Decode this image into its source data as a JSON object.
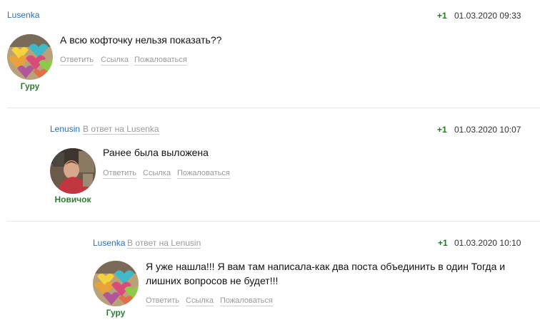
{
  "comments": [
    {
      "author": "Lusenka",
      "reply_to": "",
      "rating": "+1",
      "date": "01.03.2020 09:33",
      "rank": "Гуру",
      "text": "А всю кофточку нельзя показать??",
      "actions": {
        "reply": "Ответить",
        "link": "Ссылка",
        "report": "Пожаловаться"
      },
      "avatar": "knitted-hearts-avatar"
    },
    {
      "author": "Lenusin",
      "reply_to": "В ответ на Lusenka",
      "rating": "+1",
      "date": "01.03.2020 10:07",
      "rank": "Новичок",
      "text": "Ранее была выложена",
      "actions": {
        "reply": "Ответить",
        "link": "Ссылка",
        "report": "Пожаловаться"
      },
      "avatar": "person-photo-avatar"
    },
    {
      "author": "Lusenka",
      "reply_to": "В ответ на Lenusin",
      "rating": "+1",
      "date": "01.03.2020 10:10",
      "rank": "Гуру",
      "text_line1": "Я уже нашла!!! Я вам там написала-как два поста объединить в один Тогда и",
      "text_line2": "лишних вопросов не будет!!!",
      "actions": {
        "reply": "Ответить",
        "link": "Ссылка",
        "report": "Пожаловаться"
      },
      "avatar": "knitted-hearts-avatar"
    }
  ],
  "colors": {
    "author": "#2a6fb5",
    "rating": "#1f7a1f",
    "rank": "#2e7d32",
    "muted": "#9a9a9a"
  }
}
